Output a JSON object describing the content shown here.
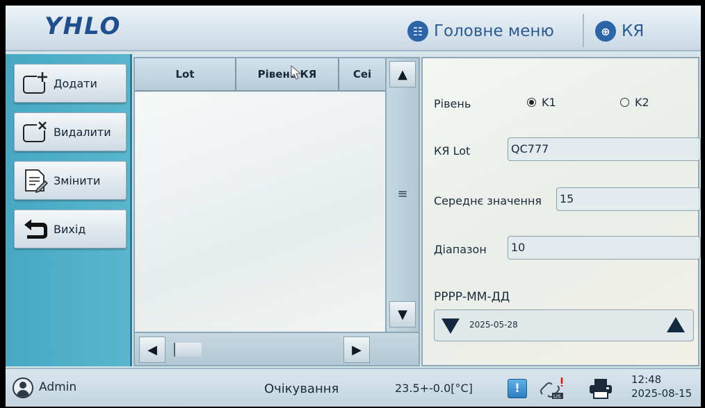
{
  "header": {
    "logo": "YHLO",
    "main_menu_label": "Головне меню",
    "qc_label": "КЯ"
  },
  "sidebar": {
    "add_label": "Додати",
    "delete_label": "Видалити",
    "edit_label": "Змінити",
    "exit_label": "Вихід"
  },
  "table": {
    "columns": [
      "Lot",
      "Рівень КЯ",
      "Сеі"
    ],
    "rows": []
  },
  "form": {
    "level_label": "Рівень",
    "level_options": [
      "K1",
      "K2"
    ],
    "level_selected": "K1",
    "lot_label": "КЯ Lot",
    "lot_value": "QC777",
    "mean_label": "Середнє значення",
    "mean_value": "15",
    "range_label": "Діапазон",
    "range_value": "10",
    "date_format_label": "РРРР-ММ-ДД",
    "date_value": "2025-05-28"
  },
  "status": {
    "user": "Admin",
    "state": "Очікування",
    "temperature": "23.5+-0.0[°C]",
    "time": "12:48",
    "date": "2025-08-15"
  },
  "colors": {
    "accent": "#2b64a8",
    "sidebar": "#47a8c4"
  }
}
